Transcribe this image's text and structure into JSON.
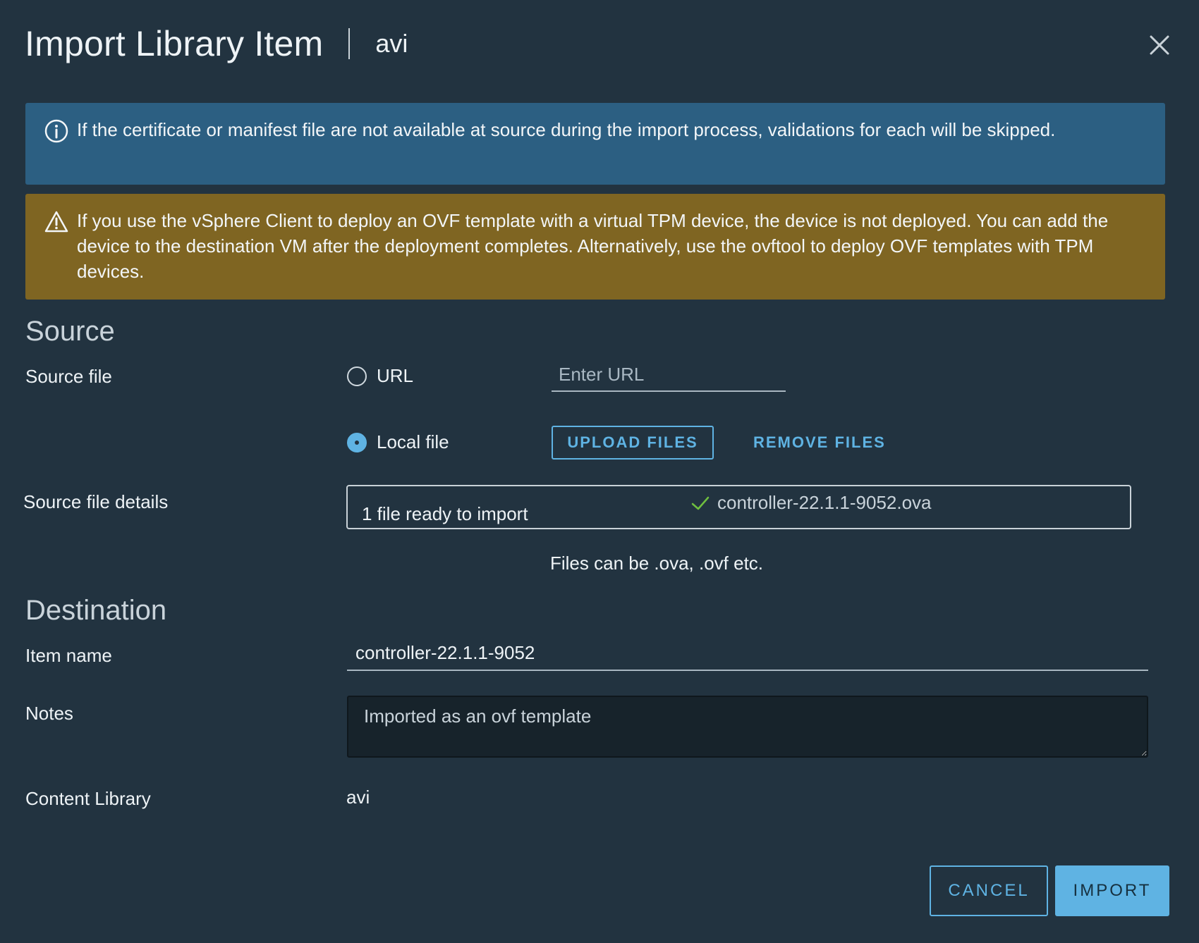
{
  "header": {
    "title": "Import Library Item",
    "subtitle": "avi"
  },
  "alerts": {
    "info": "If the certificate or manifest file are not available at source during the import process, validations for each will be skipped.",
    "warning": "If you use the vSphere Client to deploy an OVF template with a virtual TPM device, the device is not deployed. You can add the device to the destination VM after the deployment completes. Alternatively, use the ovftool to deploy OVF templates with TPM devices."
  },
  "source": {
    "section_title": "Source",
    "source_file_label": "Source file",
    "url_option_label": "URL",
    "url_option_selected": false,
    "url_placeholder": "Enter URL",
    "local_option_label": "Local file",
    "local_option_selected": true,
    "upload_button": "UPLOAD FILES",
    "remove_button": "REMOVE FILES",
    "details_label": "Source file details",
    "file_status": "1 file ready to import",
    "file_name": "controller-22.1.1-9052.ova",
    "hint": "Files can be .ova, .ovf etc."
  },
  "destination": {
    "section_title": "Destination",
    "item_name_label": "Item name",
    "item_name_value": "controller-22.1.1-9052",
    "notes_label": "Notes",
    "notes_value": "Imported as an ovf template",
    "content_library_label": "Content Library",
    "content_library_value": "avi"
  },
  "footer": {
    "cancel_button": "CANCEL",
    "import_button": "IMPORT"
  },
  "colors": {
    "background": "#223340",
    "info_alert": "#2c5f82",
    "warning_alert": "#7f6522",
    "accent": "#5fb3e3",
    "success_check": "#6fbf3f"
  },
  "icons": {
    "close": "close-icon",
    "info": "info-circle-icon",
    "warning": "warning-triangle-icon",
    "check": "check-icon"
  }
}
